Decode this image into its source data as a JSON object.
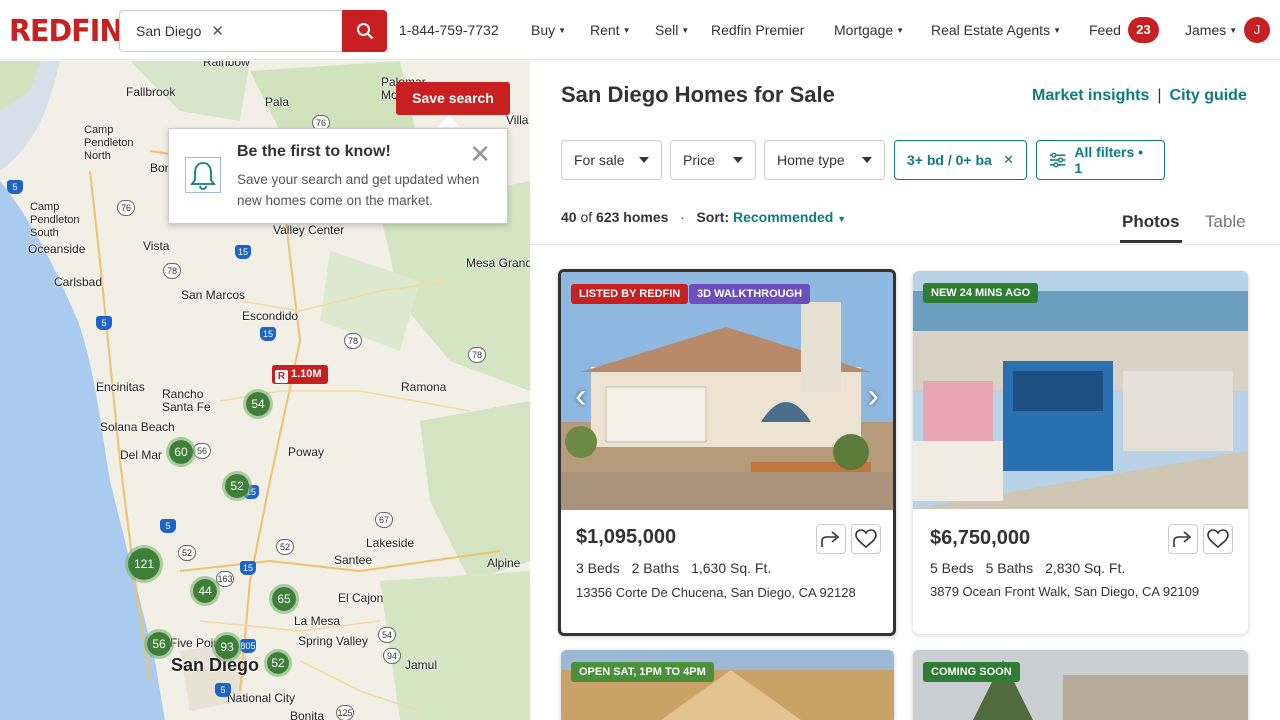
{
  "header": {
    "logo": "REDFIN",
    "search_value": "San Diego",
    "phone": "1-844-759-7732",
    "nav": [
      "Buy",
      "Rent",
      "Sell",
      "Redfin Premier",
      "Mortgage",
      "Real Estate Agents"
    ],
    "feed": "Feed",
    "feed_count": "23",
    "user": "James",
    "avatar_initial": "J"
  },
  "map": {
    "save_search": "Save search",
    "popup": {
      "title": "Be the first to know!",
      "desc": "Save your search and get updated when new homes come on the market."
    },
    "price_pin": "1.10M",
    "places": [
      "Rainbow",
      "Fallbrook",
      "Pala",
      "Camp Pendleton North",
      "Bon",
      "Camp Pendleton South",
      "Oceanside",
      "Vista",
      "Carlsbad",
      "San Marcos",
      "Valley Center",
      "Mesa Grand",
      "Escondido",
      "Encinitas",
      "Rancho Santa Fe",
      "Solana Beach",
      "Del Mar",
      "Ramona",
      "Poway",
      "Lakeside",
      "Santee",
      "El Cajon",
      "La Mesa",
      "Spring Valley",
      "Jamul",
      "Alpine",
      "San Diego",
      "National City",
      "Five Points",
      "Bonita",
      "Palomar Mountain",
      "Villa"
    ],
    "clusters": [
      "54",
      "60",
      "52",
      "121",
      "44",
      "65",
      "56",
      "93",
      "52"
    ]
  },
  "results": {
    "title": "San Diego Homes for Sale",
    "market_insights": "Market insights",
    "city_guide": "City guide",
    "filters": {
      "for_sale": "For sale",
      "price": "Price",
      "home_type": "Home type",
      "beds": "3+ bd / 0+ ba",
      "all_filters": "All filters • 1"
    },
    "count_shown": "40",
    "count_of": "of",
    "count_total": "623 homes",
    "sort_label": "Sort:",
    "sort_value": "Recommended",
    "tabs": [
      "Photos",
      "Table"
    ]
  },
  "listings": [
    {
      "tags": [
        "LISTED BY REDFIN",
        "3D WALKTHROUGH"
      ],
      "price": "$1,095,000",
      "beds": "3 Beds",
      "baths": "2 Baths",
      "sqft": "1,630 Sq. Ft.",
      "address": "13356 Corte De Chucena, San Diego, CA 92128"
    },
    {
      "tags": [
        "NEW 24 MINS AGO"
      ],
      "price": "$6,750,000",
      "beds": "5 Beds",
      "baths": "5 Baths",
      "sqft": "2,830 Sq. Ft.",
      "address": "3879 Ocean Front Walk, San Diego, CA 92109"
    },
    {
      "tags": [
        "OPEN SAT, 1PM TO 4PM"
      ]
    },
    {
      "tags": [
        "COMING SOON"
      ]
    }
  ],
  "colors": {
    "brand": "#c82021",
    "accent": "#0c7c83",
    "listed_tag": "#c82021",
    "walkthrough_tag": "#6b4fbb",
    "new_tag": "#2e7d32",
    "open_tag": "#4a8f3a",
    "coming_tag": "#2e7d32"
  },
  "icons": [
    "search-icon",
    "close-icon",
    "bell-icon",
    "share-icon",
    "heart-icon",
    "chevron-left-icon",
    "chevron-right-icon",
    "sliders-icon"
  ]
}
